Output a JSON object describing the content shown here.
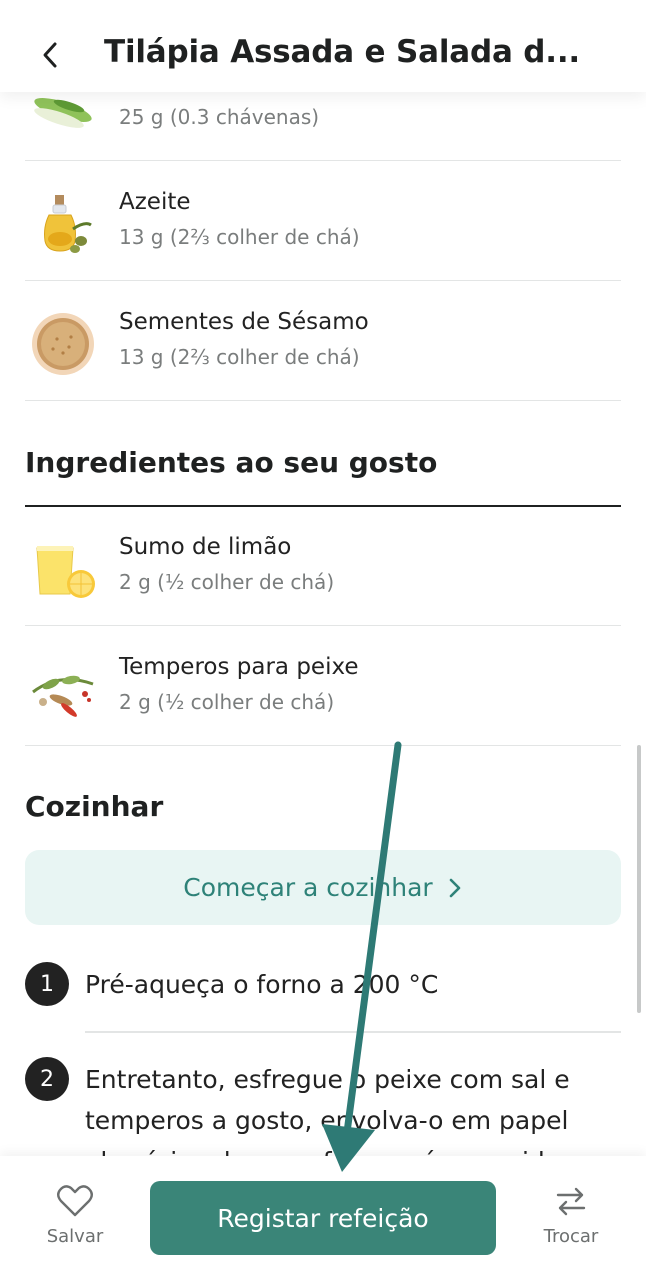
{
  "header": {
    "title": "Tilápia Assada e Salada d..."
  },
  "ingredients": [
    {
      "name": "",
      "amount": "25 g (0.3 chávenas)",
      "icon": "leek-icon"
    },
    {
      "name": "Azeite",
      "amount": "13 g (2⅔ colher de chá)",
      "icon": "olive-oil-icon"
    },
    {
      "name": "Sementes de Sésamo",
      "amount": "13 g (2⅔ colher de chá)",
      "icon": "sesame-seeds-icon"
    }
  ],
  "to_taste": {
    "title": "Ingredientes ao seu gosto",
    "items": [
      {
        "name": "Sumo de limão",
        "amount": "2 g (½ colher de chá)",
        "icon": "lemon-juice-icon"
      },
      {
        "name": "Temperos para peixe",
        "amount": "2 g (½ colher de chá)",
        "icon": "fish-spices-icon"
      }
    ]
  },
  "cook": {
    "title": "Cozinhar",
    "start_label": "Começar a cozinhar",
    "steps": [
      {
        "number": "1",
        "text": "Pré-aqueça o forno a 200 °C"
      },
      {
        "number": "2",
        "text": "Entretanto, esfregue o peixe com sal e temperos a gosto, envolva-o em papel alumínio e leve ao forno pré-aquecido por"
      }
    ]
  },
  "bottom_bar": {
    "save_label": "Salvar",
    "register_label": "Registar refeição",
    "swap_label": "Trocar"
  },
  "colors": {
    "accent": "#3a8578",
    "accent_light": "#e8f5f3",
    "annotation_arrow": "#2e7a75"
  }
}
